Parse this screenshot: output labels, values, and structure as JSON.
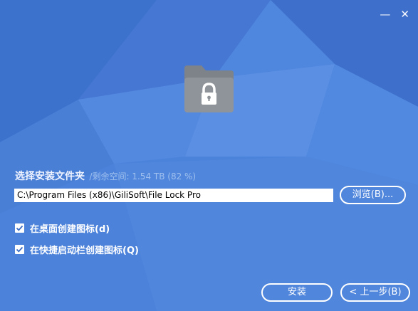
{
  "window": {
    "controls": {
      "minimize_glyph": "—",
      "close_glyph": "✕"
    }
  },
  "install_folder": {
    "label": "选择安装文件夹",
    "free_space": "/剩余空间: 1.54 TB (82 %)",
    "path_value": "C:\\Program Files (x86)\\GiliSoft\\File Lock Pro",
    "browse_label": "浏览(B)..."
  },
  "options": [
    {
      "label": "在桌面创建图标(d)",
      "checked": true
    },
    {
      "label": "在快捷启动栏创建图标(Q)",
      "checked": true
    }
  ],
  "footer": {
    "install_label": "安装",
    "back_label": "< 上一步(B)"
  },
  "icons": {
    "app": "folder-lock-icon",
    "checkbox": "checkmark-icon"
  },
  "colors": {
    "background": "#4a80d8",
    "accent_text": "#9fc0ee",
    "icon_gray": "#8f949a"
  }
}
